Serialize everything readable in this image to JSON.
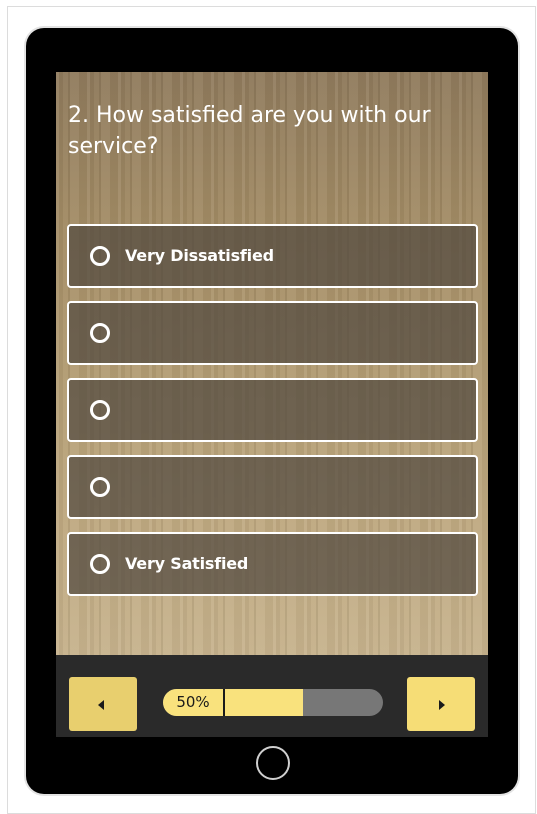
{
  "survey": {
    "question": "2. How satisfied are you with our service?",
    "options": [
      {
        "label": "Very Dissatisfied"
      },
      {
        "label": ""
      },
      {
        "label": ""
      },
      {
        "label": ""
      },
      {
        "label": "Very Satisfied"
      }
    ]
  },
  "navigation": {
    "prev_icon": "caret-left-icon",
    "next_icon": "caret-right-icon",
    "progress_percent": 50,
    "progress_label": "50%"
  },
  "colors": {
    "accent_yellow": "#f6dd76",
    "progress_track": "#777777",
    "option_background": "rgba(80,72,62,0.72)",
    "device_frame": "#000000"
  }
}
